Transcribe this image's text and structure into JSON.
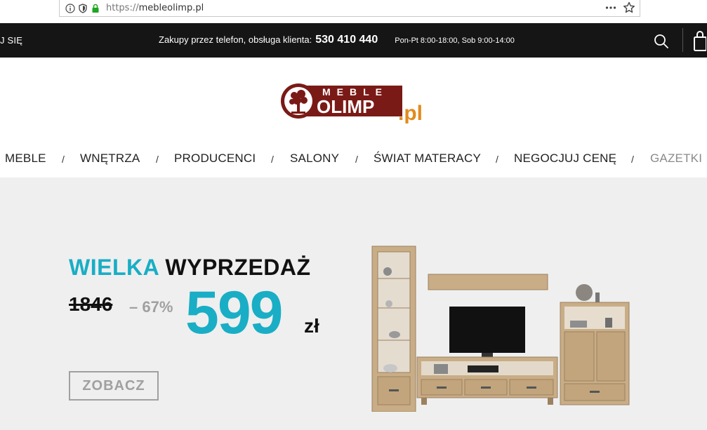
{
  "browser": {
    "url_protocol": "https://",
    "url_host": "mebleolimp.pl"
  },
  "topbar": {
    "login": "J SIĘ",
    "phone_label": "Zakupy przez telefon, obsługa klienta:",
    "phone_number": "530 410 440",
    "hours": "Pon-Pt 8:00-18:00, Sob 9:00-14:00"
  },
  "logo": {
    "line1": "MEBLE",
    "line2": "OLIMP",
    "tld": ".pl"
  },
  "nav": {
    "items": [
      "MEBLE",
      "WNĘTRZA",
      "PRODUCENCI",
      "SALONY",
      "ŚWIAT MATERACY",
      "NEGOCJUJ CENĘ",
      "GAZETKI"
    ],
    "separator": "/"
  },
  "hero": {
    "headline_accent": "WIELKA",
    "headline_rest": "WYPRZEDAŻ",
    "old_price": "1846",
    "discount": "– 67%",
    "new_price": "599",
    "currency": "zł",
    "cta_label": "ZOBACZ"
  },
  "colors": {
    "accent": "#19aec5",
    "topbar_bg": "#151515",
    "hero_bg": "#efefef",
    "logo_red": "#7a1a16",
    "logo_orange": "#e38a1e"
  },
  "icons": {
    "info": "info-icon",
    "shield": "shield-icon",
    "lock": "lock-icon",
    "more": "more-icon",
    "star": "star-icon",
    "search": "search-icon",
    "cart": "shopping-bag-icon"
  }
}
